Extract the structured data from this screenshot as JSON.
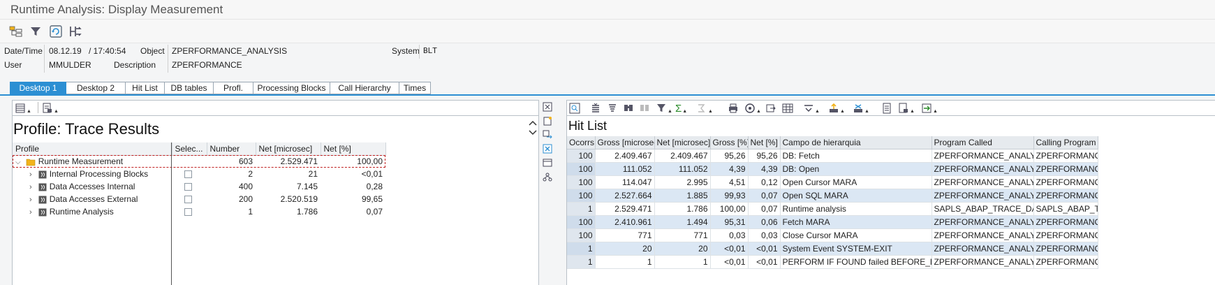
{
  "window": {
    "title": "Runtime Analysis: Display Measurement"
  },
  "toolbar": {
    "icons": [
      "hierarchy-icon",
      "filter-icon",
      "refresh-icon",
      "compare-icon"
    ]
  },
  "header": {
    "datetime_label": "Date/Time",
    "date": "08.12.19",
    "time": "/ 17:40:54",
    "object_label": "Object",
    "object_value": "ZPERFORMANCE_ANALYSIS",
    "system_label": "System",
    "system_value": "BLT",
    "user_label": "User",
    "user_value": "MMULDER",
    "description_label": "Description",
    "description_value": "ZPERFORMANCE"
  },
  "tabs": [
    {
      "label": "Desktop 1",
      "active": true
    },
    {
      "label": "Desktop 2"
    },
    {
      "label": "Hit List"
    },
    {
      "label": "DB tables"
    },
    {
      "label": "Profl."
    },
    {
      "label": "Processing Blocks"
    },
    {
      "label": "Call Hierarchy"
    },
    {
      "label": "Times"
    }
  ],
  "profile": {
    "title": "Profile: Trace Results",
    "columns": [
      "Profile",
      "Selec...",
      "Number",
      "Net [microsec]",
      "Net [%]"
    ],
    "root": {
      "label": "Runtime Measurement",
      "number": "603",
      "net": "2.529.471",
      "pct": "100,00"
    },
    "rows": [
      {
        "label": "Internal Processing Blocks",
        "number": "2",
        "net": "21",
        "pct": "<0,01"
      },
      {
        "label": "Data Accesses Internal",
        "number": "400",
        "net": "7.145",
        "pct": "0,28"
      },
      {
        "label": "Data Accesses External",
        "number": "200",
        "net": "2.520.519",
        "pct": "99,65"
      },
      {
        "label": "Runtime Analysis",
        "number": "1",
        "net": "1.786",
        "pct": "0,07"
      }
    ]
  },
  "hitlist": {
    "title": "Hit List",
    "columns": [
      "Ocorrs.",
      "Gross [microsec]",
      "Net [microsec]",
      "Gross [%]",
      "Net [%]",
      "Campo de hierarquia",
      "Program Called",
      "Calling Program"
    ],
    "rows": [
      [
        "100",
        "2.409.467",
        "2.409.467",
        "95,26",
        "95,26",
        "DB: Fetch",
        "ZPERFORMANCE_ANALYSIS",
        "ZPERFORMANCE_"
      ],
      [
        "100",
        "111.052",
        "111.052",
        "4,39",
        "4,39",
        "DB: Open",
        "ZPERFORMANCE_ANALYSIS",
        "ZPERFORMANCE_"
      ],
      [
        "100",
        "114.047",
        "2.995",
        "4,51",
        "0,12",
        "Open Cursor MARA",
        "ZPERFORMANCE_ANALYSIS",
        "ZPERFORMANCE_"
      ],
      [
        "100",
        "2.527.664",
        "1.885",
        "99,93",
        "0,07",
        "Open SQL MARA",
        "ZPERFORMANCE_ANALYSIS",
        "ZPERFORMANCE_"
      ],
      [
        "1",
        "2.529.471",
        "1.786",
        "100,00",
        "0,07",
        "Runtime analysis",
        "SAPLS_ABAP_TRACE_DATA",
        "SAPLS_ABAP_TR"
      ],
      [
        "100",
        "2.410.961",
        "1.494",
        "95,31",
        "0,06",
        "Fetch MARA",
        "ZPERFORMANCE_ANALYSIS",
        "ZPERFORMANCE_"
      ],
      [
        "100",
        "771",
        "771",
        "0,03",
        "0,03",
        "Close Cursor MARA",
        "ZPERFORMANCE_ANALYSIS",
        "ZPERFORMANCE_"
      ],
      [
        "1",
        "20",
        "20",
        "<0,01",
        "<0,01",
        "System Event SYSTEM-EXIT",
        "ZPERFORMANCE_ANALYSIS",
        "ZPERFORMANCE_"
      ],
      [
        "1",
        "1",
        "1",
        "<0,01",
        "<0,01",
        "PERFORM IF FOUND failed BEFORE_EVENT",
        "ZPERFORMANCE_ANALYSIS",
        "ZPERFORMANCE_"
      ]
    ]
  },
  "colors": {
    "accent": "#2c8fd3",
    "folder": "#f2b31b",
    "row_alt": "#dbe7f4"
  }
}
